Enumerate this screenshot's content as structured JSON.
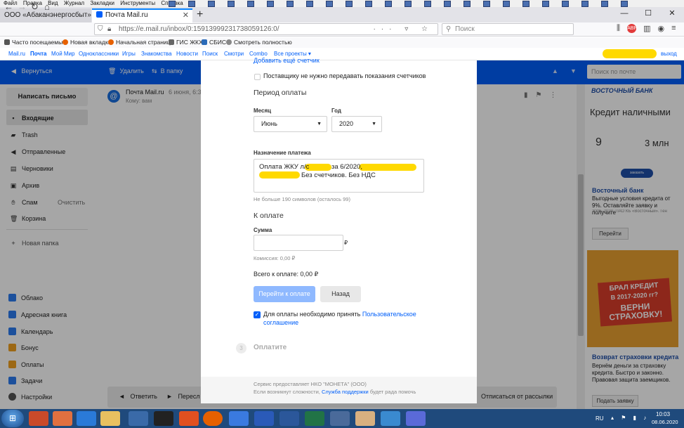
{
  "menubar": {
    "items": [
      "Файл",
      "Правка",
      "Вид",
      "Журнал",
      "Закладки",
      "Инструменты",
      "Справка"
    ]
  },
  "tabs": [
    {
      "label": "ООО «Абаканэнергосбыт» - Обра"
    },
    {
      "label": "Почта Mail.ru"
    }
  ],
  "nav": {
    "url": "https://e.mail.ru/inbox/0:15913999231738059126:0/",
    "search_placeholder": "Поиск"
  },
  "bookmarks": [
    "Часто посещаемые",
    "Новая вкладка",
    "Начальная страница",
    "ГИС ЖКХ",
    "СБИС",
    "Смотреть полностью"
  ],
  "portal": {
    "links": [
      "Mail.ru",
      "Почта",
      "Мой Мир",
      "Одноклассники",
      "Игры",
      "Знакомства",
      "Новости",
      "Поиск",
      "Смотри",
      "Combo",
      "Все проекты ▾"
    ],
    "logout": "выход"
  },
  "mailbar": {
    "back": "Вернуться",
    "delete": "Удалить",
    "to_folder": "В папку",
    "more": "Ещё",
    "search_placeholder": "Поиск по почте"
  },
  "sidebar": {
    "compose": "Написать письмо",
    "folders": [
      "Входящие",
      "Trash",
      "Отправленные",
      "Черновики",
      "Архив",
      "Спам",
      "Корзина"
    ],
    "spam_clear": "Очистить",
    "new_folder": "Новая папка",
    "apps": [
      "Облако",
      "Адресная книга",
      "Календарь",
      "Бонус",
      "Оплаты",
      "Задачи",
      "Настройки"
    ]
  },
  "message": {
    "from": "Почта Mail.ru",
    "date": "6 июня, 6:32",
    "to": "Кому: вам"
  },
  "replybar": {
    "reply": "Ответить",
    "forward": "Пересл",
    "unsubscribe": "Отписаться от рассылки"
  },
  "payment": {
    "add_counter": "Добавить ещё счетчик",
    "no_counters": "Поставщику не нужно передавать показания счетчиков",
    "period_title": "Период оплаты",
    "month_label": "Месяц",
    "month_value": "Июнь",
    "year_label": "Год",
    "year_value": "2020",
    "purpose_label": "Назначение платежа",
    "purpose_line1_a": "Оплата ЖКУ л/с",
    "purpose_line1_b": "за 6/2020,",
    "purpose_line2": "Без счетчиков. Без НДС",
    "char_limit": "Не больше 190 символов (осталось 99)",
    "to_pay_title": "К оплате",
    "sum_label": "Сумма",
    "currency": "₽",
    "commission": "Комиссия: 0,00 ₽",
    "total": "Всего к оплате: 0,00 ₽",
    "next_button": "Перейти к оплате",
    "back_button": "Назад",
    "agree_text": "Для оплаты необходимо принять",
    "agree_link_1": "Пользовательское",
    "agree_link_2": "соглашение",
    "step_number": "3",
    "step_title": "Оплатите",
    "footer_line1": "Сервис предоставляет НКО \"МОНЕТА\" (ООО)",
    "footer_line2_a": "Если возникнут сложности,",
    "footer_line2_link": "Служба поддержки",
    "footer_line2_b": "будет рада помочь"
  },
  "ads": {
    "bank_logo": "ВОСТОЧНЫЙ БАНК",
    "headline": "Кредит наличными",
    "rate": "9",
    "amount": "3 млн",
    "order_btn": "заказать",
    "title1": "Восточный банк",
    "text1": "Выгодные условия кредита от 9%. Оставляйте заявку и получите",
    "legal1": "2006–2020. ПАО КБ «Восточный». Ген",
    "btn1": "Перейти",
    "banner_line1": "БРАЛ КРЕДИТ",
    "banner_line2": "В 2017-2020 гг?",
    "banner_line3": "ВЕРНИ",
    "banner_line4": "СТРАХОВКУ!",
    "title2": "Возврат страховки кредита",
    "text2": "Вернём деньги за страховку кредита. Быстро и законно. Правовая защита заемщиков.",
    "btn2": "Подать заявку"
  },
  "taskbar": {
    "lang": "RU",
    "time": "10:03",
    "date": "08.06.2020"
  }
}
